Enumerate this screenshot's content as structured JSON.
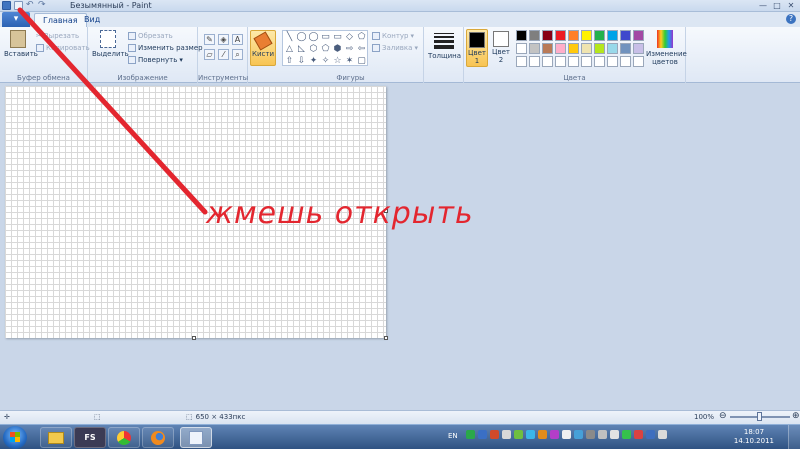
{
  "window": {
    "title": "Безымянный - Paint",
    "controls": {
      "minimize": "—",
      "maximize": "□",
      "close": "✕"
    }
  },
  "tabs": [
    {
      "label": "Главная",
      "active": true
    },
    {
      "label": "Вид",
      "active": false
    }
  ],
  "ribbon": {
    "clipboard": {
      "label": "Буфер обмена",
      "paste": "Вставить",
      "cut": "Вырезать",
      "copy": "Копировать"
    },
    "image": {
      "label": "Изображение",
      "select": "Выделить",
      "crop": "Обрезать",
      "resize": "Изменить размер",
      "rotate": "Повернуть"
    },
    "tools": {
      "label": "Инструменты"
    },
    "brushes": {
      "label": "Кисти"
    },
    "shapes": {
      "label": "Фигуры",
      "outline": "Контур",
      "fill": "Заливка",
      "glyphs": [
        "╲",
        "◯",
        "◯",
        "▭",
        "▭",
        "◇",
        "⬠",
        "△",
        "◺",
        "⬡",
        "⬠",
        "⬢",
        "⇨",
        "⇦",
        "⇧",
        "⇩",
        "✦",
        "✧",
        "☆",
        "✶",
        "▢"
      ]
    },
    "size": {
      "label": "Толщина"
    },
    "colors": {
      "label": "Цвета",
      "color1": "Цвет 1",
      "color2": "Цвет 2",
      "edit": "Изменение цветов",
      "color1_value": "#000000",
      "color2_value": "#ffffff",
      "palette": [
        "#000000",
        "#7f7f7f",
        "#880015",
        "#ed1c24",
        "#ff7f27",
        "#fff200",
        "#22b14c",
        "#00a2e8",
        "#3f48cc",
        "#a349a4",
        "#ffffff",
        "#c3c3c3",
        "#b97a57",
        "#ffaec9",
        "#ffc90e",
        "#efe4b0",
        "#b5e61d",
        "#99d9ea",
        "#7092be",
        "#c8bfe7",
        "#ffffff",
        "#ffffff",
        "#ffffff",
        "#ffffff",
        "#ffffff",
        "#ffffff",
        "#ffffff",
        "#ffffff",
        "#ffffff",
        "#ffffff"
      ]
    }
  },
  "annotation": {
    "text": "жмешь открыть",
    "color": "#e3262f"
  },
  "statusbar": {
    "dimensions": "650 × 433пкс",
    "zoom": "100%"
  },
  "taskbar": {
    "apps": [
      {
        "name": "explorer",
        "label": ""
      },
      {
        "name": "fs",
        "label": "FS"
      },
      {
        "name": "chrome-like",
        "label": ""
      },
      {
        "name": "firefox",
        "label": ""
      },
      {
        "name": "paint",
        "label": ""
      }
    ],
    "language": "EN",
    "time": "18:07",
    "date": "14.10.2011"
  }
}
